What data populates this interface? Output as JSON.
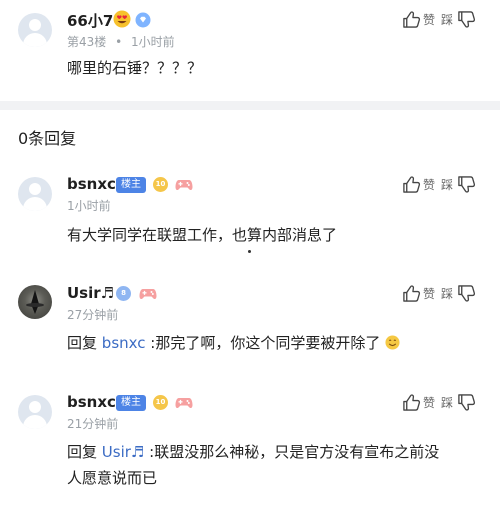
{
  "top_post": {
    "username": "66小7",
    "floor": "第43楼",
    "separator": "•",
    "time": "1小时前",
    "text": "哪里的石锤？？？？",
    "like_label": "赞",
    "dislike_label": "踩"
  },
  "replies_header": "0条回复",
  "comments": [
    {
      "username": "bsnxc",
      "badge": "楼主",
      "level": "10",
      "time": "1小时前",
      "text": "有大学同学在联盟工作，也算内部消息了",
      "like_label": "赞",
      "dislike_label": "踩"
    },
    {
      "username": "Usir♬",
      "level": "8",
      "time": "27分钟前",
      "reply_prefix": "回复",
      "reply_to": "bsnxc",
      "text": " :那完了啊，你这个同学要被开除了",
      "like_label": "赞",
      "dislike_label": "踩"
    },
    {
      "username": "bsnxc",
      "badge": "楼主",
      "level": "10",
      "time": "21分钟前",
      "reply_prefix": "回复",
      "reply_to": "Usir♬",
      "text_line1": " :联盟没那么神秘，只是官方没有宣布之前没",
      "text_line2": "人愿意说而已",
      "like_label": "赞",
      "dislike_label": "踩"
    }
  ],
  "colors": {
    "owner_badge": "#4d84e6",
    "mention": "#3c6cc4",
    "meta": "#9aa0a6",
    "divider": "#f1f2f4"
  }
}
